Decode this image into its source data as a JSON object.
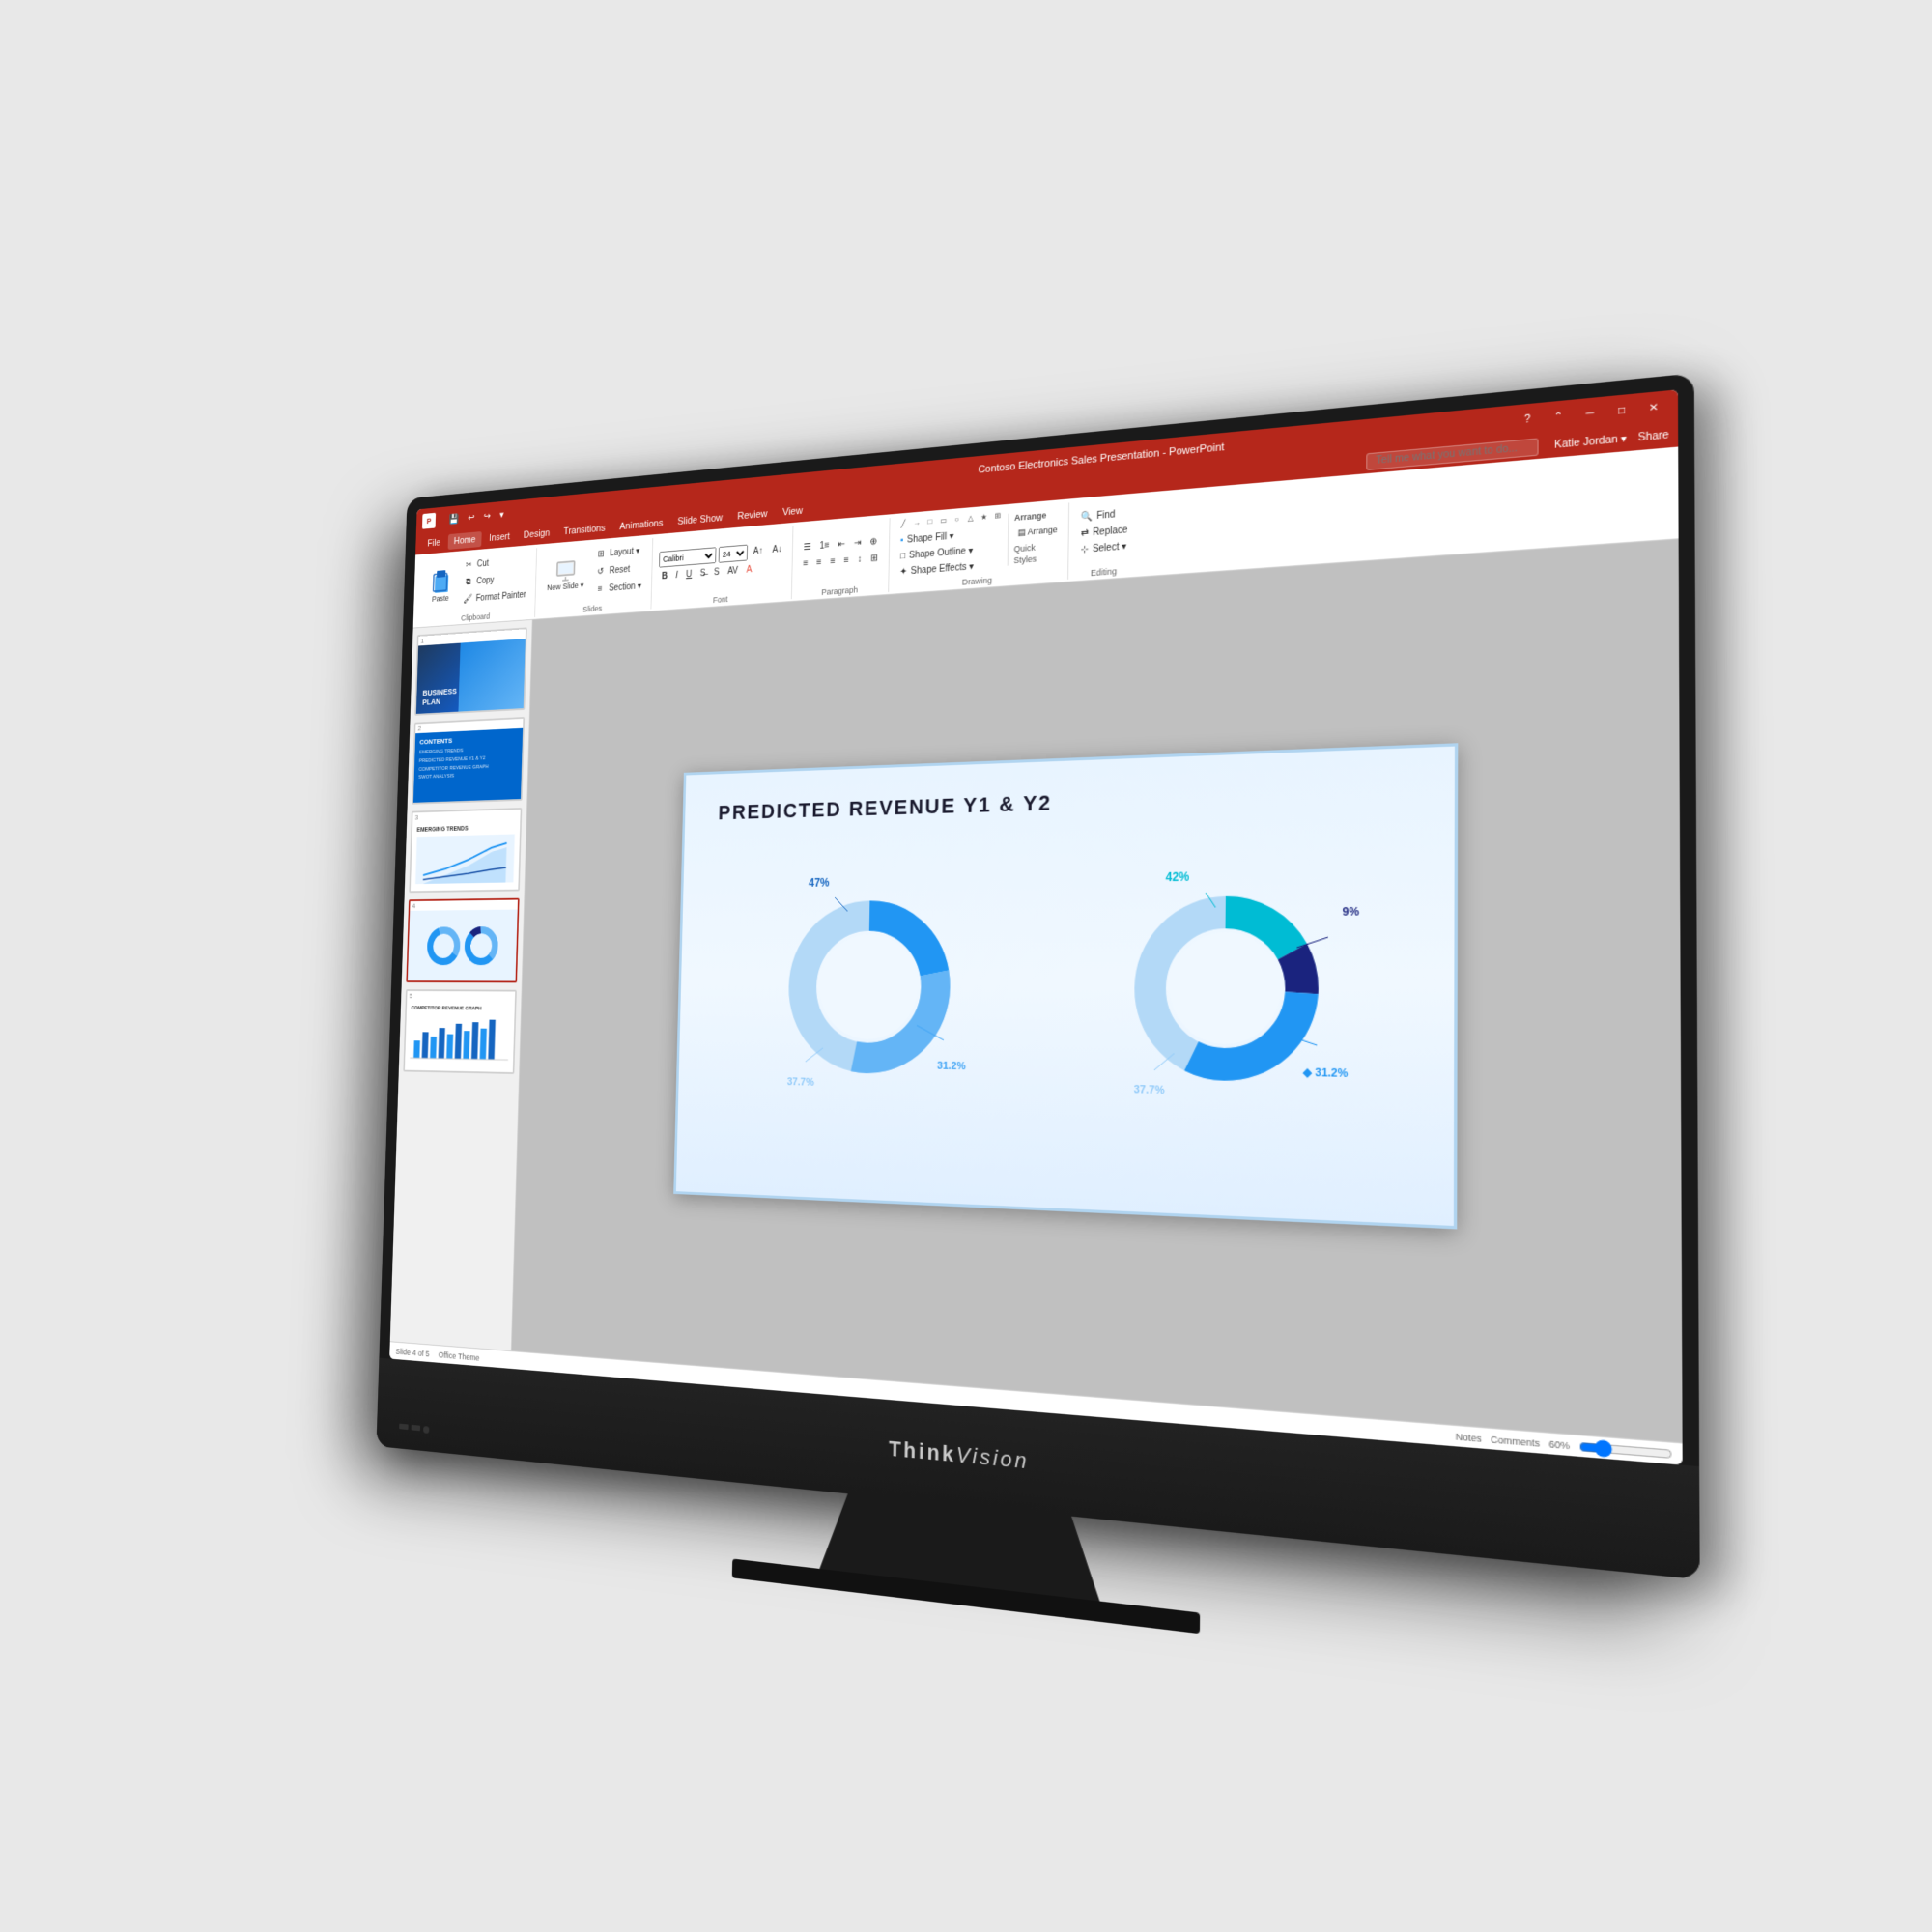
{
  "monitor": {
    "brand": "ThinkVision",
    "brand_think": "Think",
    "brand_vision": "Vision"
  },
  "titlebar": {
    "app_icon": "P",
    "title": "Contoso Electronics Sales Presentation - PowerPoint",
    "quick_save": "💾",
    "undo": "↩",
    "redo": "↪",
    "dropdown": "▾",
    "user": "Katie Jordan ▾",
    "share": "Share",
    "minimize": "─",
    "maximize": "□",
    "close": "✕"
  },
  "menubar": {
    "items": [
      "File",
      "Home",
      "Insert",
      "Design",
      "Transitions",
      "Animations",
      "Slide Show",
      "Review",
      "View"
    ],
    "active": "Home",
    "search_placeholder": "Tell me what you want to do...",
    "share_label": "Share"
  },
  "ribbon": {
    "clipboard": {
      "label": "Clipboard",
      "paste_label": "Paste",
      "cut_label": "Cut",
      "copy_label": "Copy",
      "format_painter_label": "Format Painter"
    },
    "slides": {
      "label": "Slides",
      "new_label": "New Slide ▾",
      "layout_label": "Layout ▾",
      "reset_label": "Reset",
      "section_label": "Section ▾"
    },
    "font": {
      "label": "Font"
    },
    "paragraph": {
      "label": "Paragraph"
    },
    "drawing": {
      "label": "Drawing",
      "shape_fill": "Shape Fill ▾",
      "shape_outline": "Shape Outline ▾",
      "shape_effects": "Shape Effects ▾"
    },
    "editing": {
      "label": "Editing",
      "find_label": "Find",
      "replace_label": "Replace",
      "select_label": "Select ▾"
    }
  },
  "slides": {
    "panel_items": [
      {
        "id": 1,
        "title": "BUSINESS PLAN",
        "active": false
      },
      {
        "id": 2,
        "title": "CONTENTS",
        "active": false
      },
      {
        "id": 3,
        "title": "EMERGING TRENDS",
        "active": false
      },
      {
        "id": 4,
        "title": "PREDICTED REVENUE Y1 & Y2",
        "active": true
      },
      {
        "id": 5,
        "title": "COMPETITOR REVENUE GRAPH",
        "active": false
      }
    ],
    "slide2_items": [
      "EMERGING TRENDS",
      "PREDICTED REVENUE Y1 & Y2",
      "COMPETITOR REVENUE GRAPH",
      "SWOT ANALYSIS"
    ]
  },
  "main_slide": {
    "title": "PREDICTED REVENUE Y1 & Y2",
    "chart1": {
      "segments": [
        {
          "label": "47%",
          "color": "#2196f3",
          "position": "top-left"
        },
        {
          "label": "31.2%",
          "color": "#64b5f6",
          "position": "bottom-right"
        },
        {
          "label": "37.7%",
          "color": "#90caf9",
          "position": "bottom-left"
        }
      ]
    },
    "chart2": {
      "segments": [
        {
          "label": "42%",
          "color": "#2196f3",
          "position": "top"
        },
        {
          "label": "9%",
          "color": "#1a237e",
          "position": "right"
        },
        {
          "label": "31.2%",
          "color": "#64b5f6",
          "position": "bottom-right"
        },
        {
          "label": "37.7%",
          "color": "#90caf9",
          "position": "bottom-left"
        }
      ]
    }
  },
  "statusbar": {
    "slide_count": "Slide 4 of 5",
    "theme": "Office Theme",
    "notes": "Notes",
    "comments": "Comments",
    "zoom": "60%"
  }
}
